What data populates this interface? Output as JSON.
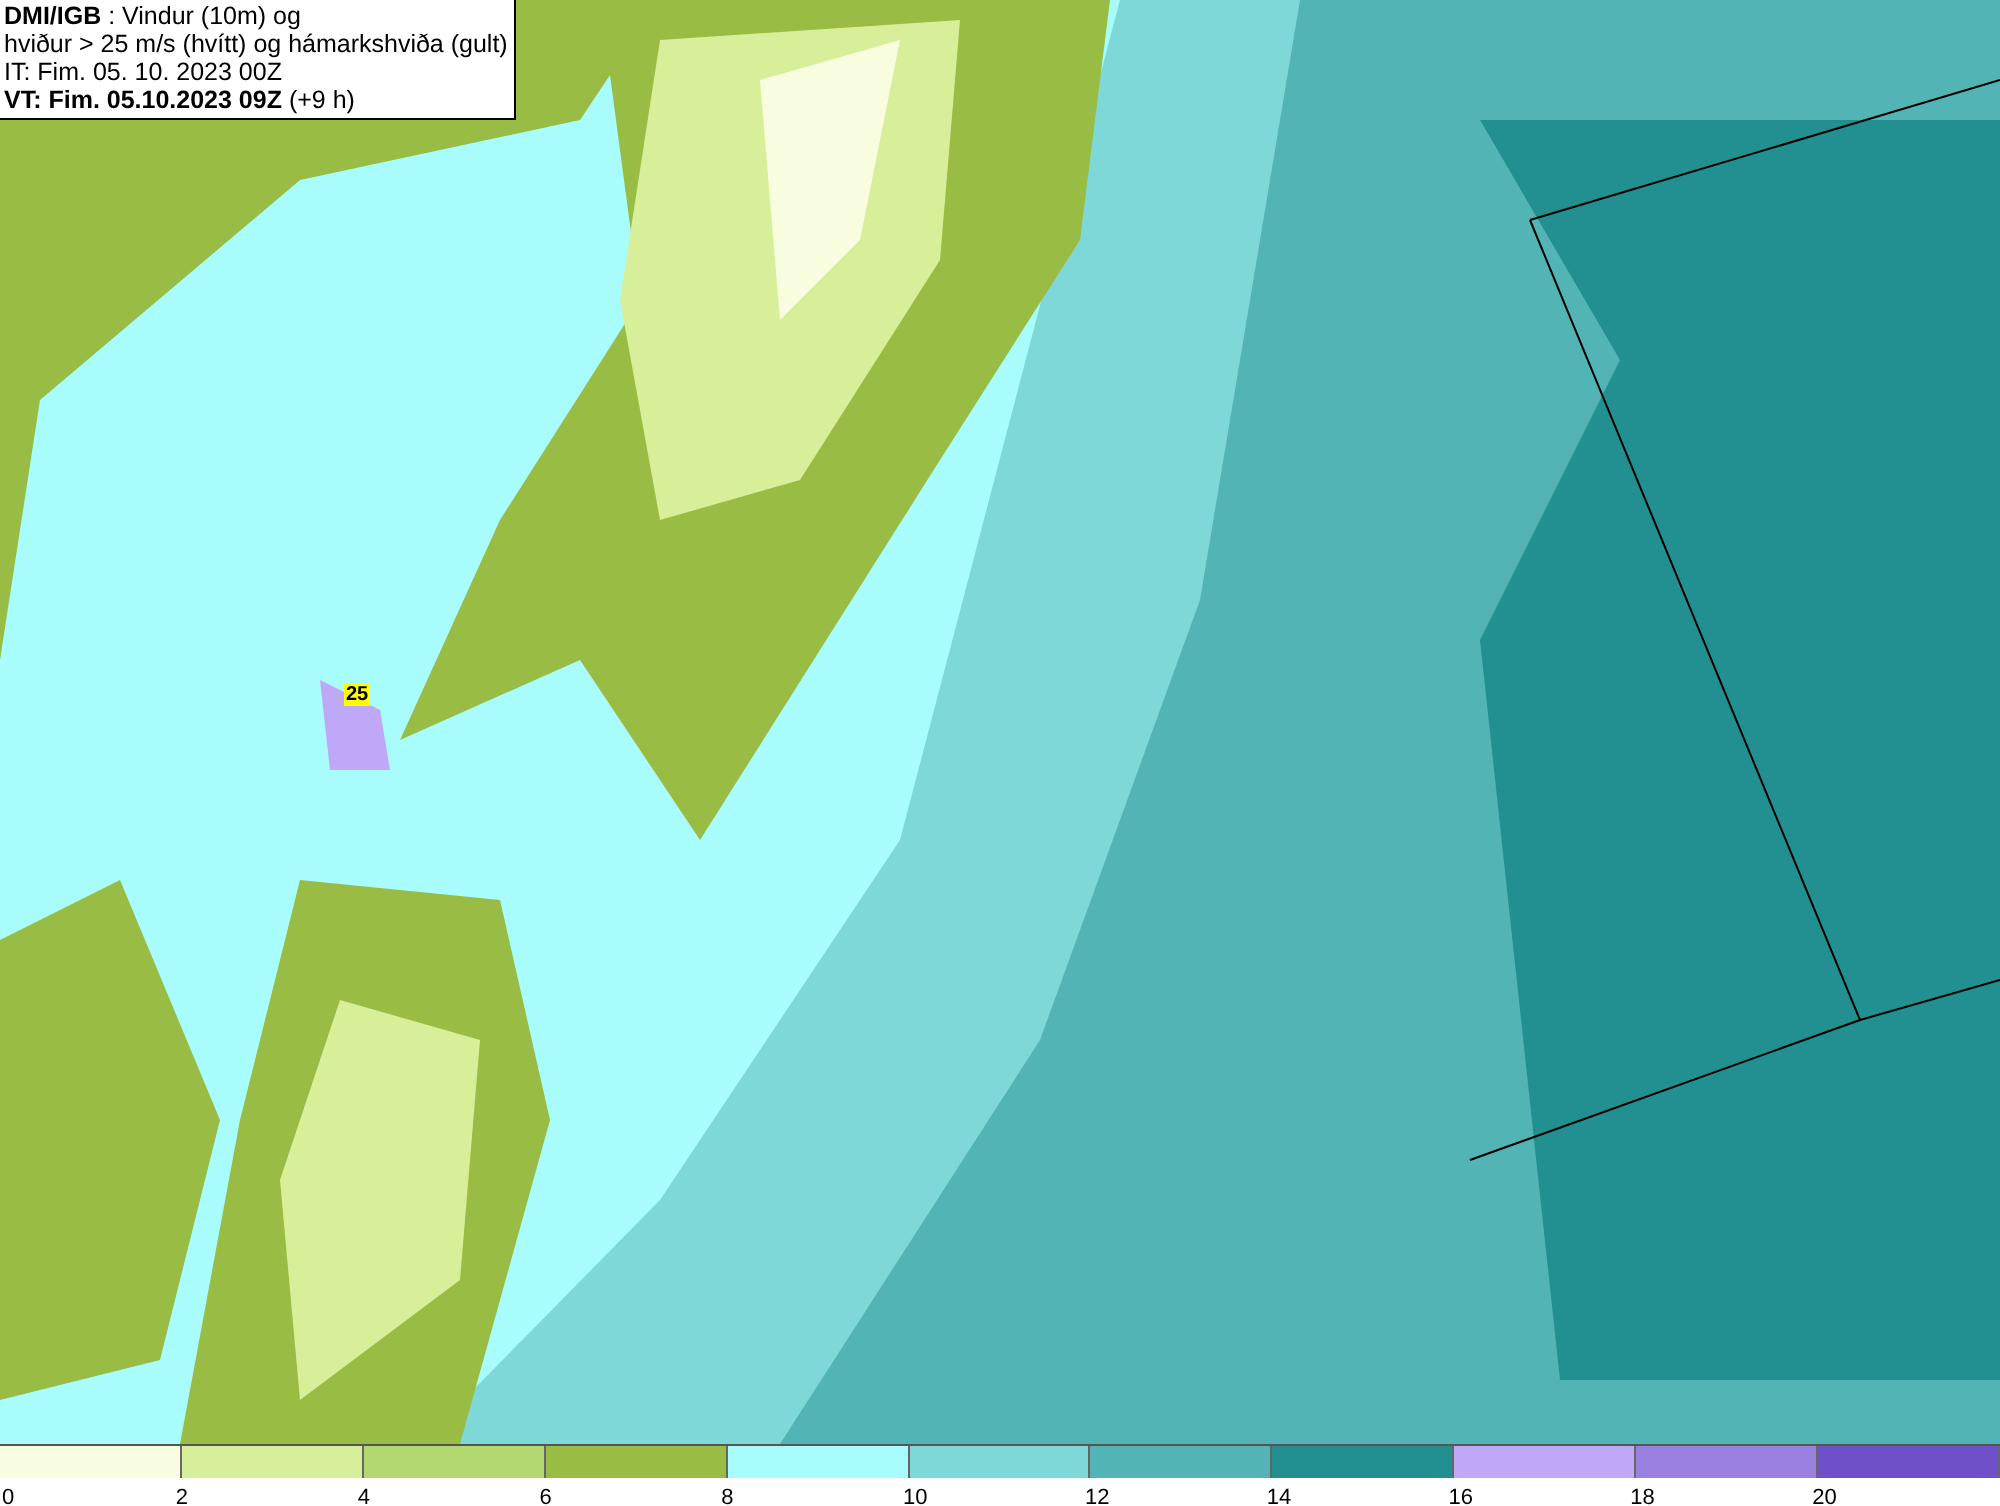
{
  "map": {
    "info_box": {
      "lines": [
        "**DMI/IGB** : Vindur (10m) og",
        "hviður > 25 m/s (hvítt) og hámarkshviða (gult)",
        "IT: Fim. 05. 10. 2023 00Z",
        "**VT: Fim. 05.10.2023 09Z** (+9 h)"
      ]
    },
    "gust_marker": "25"
  },
  "legend": [
    {
      "label": "0",
      "color": "#f8fde0"
    },
    {
      "label": "2",
      "color": "#d8ef9a"
    },
    {
      "label": "4",
      "color": "#b4d870"
    },
    {
      "label": "6",
      "color": "#98bc44"
    },
    {
      "label": "8",
      "color": "#a8fcfc"
    },
    {
      "label": "10",
      "color": "#7ed8d8"
    },
    {
      "label": "12",
      "color": "#52b4b4"
    },
    {
      "label": "14",
      "color": "#229090"
    },
    {
      "label": "16",
      "color": "#c0a8f8"
    },
    {
      "label": "18",
      "color": "#9a80e0"
    },
    {
      "label": "20",
      "color": "#7050c8"
    }
  ]
}
